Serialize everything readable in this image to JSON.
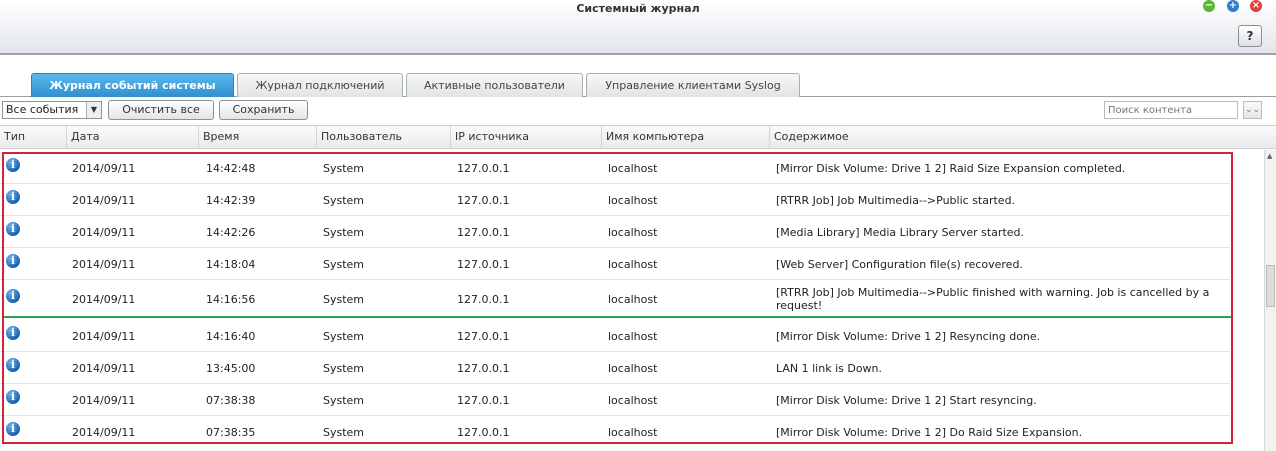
{
  "window": {
    "title": "Системный журнал",
    "help_label": "?"
  },
  "tabs": [
    {
      "label": "Журнал событий системы",
      "active": true
    },
    {
      "label": "Журнал подключений",
      "active": false
    },
    {
      "label": "Активные пользователи",
      "active": false
    },
    {
      "label": "Управление клиентами Syslog",
      "active": false
    }
  ],
  "toolbar": {
    "filter_value": "Все события",
    "clear_label": "Очистить все",
    "save_label": "Сохранить",
    "search_placeholder": "Поиск контента"
  },
  "table": {
    "columns": [
      "Тип",
      "Дата",
      "Время",
      "Пользователь",
      "IP источника",
      "Имя компьютера",
      "Содержимое"
    ],
    "rows": [
      {
        "type": "info",
        "date": "2014/09/11",
        "time": "14:42:48",
        "user": "System",
        "ip": "127.0.0.1",
        "host": "localhost",
        "content": "[Mirror Disk Volume: Drive 1 2] Raid Size Expansion completed."
      },
      {
        "type": "info",
        "date": "2014/09/11",
        "time": "14:42:39",
        "user": "System",
        "ip": "127.0.0.1",
        "host": "localhost",
        "content": "[RTRR Job] Job Multimedia-->Public started."
      },
      {
        "type": "info",
        "date": "2014/09/11",
        "time": "14:42:26",
        "user": "System",
        "ip": "127.0.0.1",
        "host": "localhost",
        "content": "[Media Library] Media Library Server started."
      },
      {
        "type": "info",
        "date": "2014/09/11",
        "time": "14:18:04",
        "user": "System",
        "ip": "127.0.0.1",
        "host": "localhost",
        "content": "[Web Server] Configuration file(s) recovered."
      },
      {
        "type": "info",
        "date": "2014/09/11",
        "time": "14:16:56",
        "user": "System",
        "ip": "127.0.0.1",
        "host": "localhost",
        "content": "[RTRR Job] Job Multimedia-->Public finished with warning. Job is cancelled by a",
        "content2": "request!"
      },
      {
        "type": "info",
        "date": "2014/09/11",
        "time": "14:16:40",
        "user": "System",
        "ip": "127.0.0.1",
        "host": "localhost",
        "content": "[Mirror Disk Volume: Drive 1 2] Resyncing done."
      },
      {
        "type": "info",
        "date": "2014/09/11",
        "time": "13:45:00",
        "user": "System",
        "ip": "127.0.0.1",
        "host": "localhost",
        "content": "LAN 1 link is Down."
      },
      {
        "type": "info",
        "date": "2014/09/11",
        "time": "07:38:38",
        "user": "System",
        "ip": "127.0.0.1",
        "host": "localhost",
        "content": "[Mirror Disk Volume: Drive 1 2] Start resyncing."
      },
      {
        "type": "info",
        "date": "2014/09/11",
        "time": "07:38:35",
        "user": "System",
        "ip": "127.0.0.1",
        "host": "localhost",
        "content": "[Mirror Disk Volume: Drive 1 2] Do Raid Size Expansion."
      }
    ]
  },
  "colors": {
    "active_tab": "#2f8fd0",
    "highlight_box": "#d2233a",
    "divider_line": "#2aa54a",
    "info_icon": "#1d5fb3"
  }
}
